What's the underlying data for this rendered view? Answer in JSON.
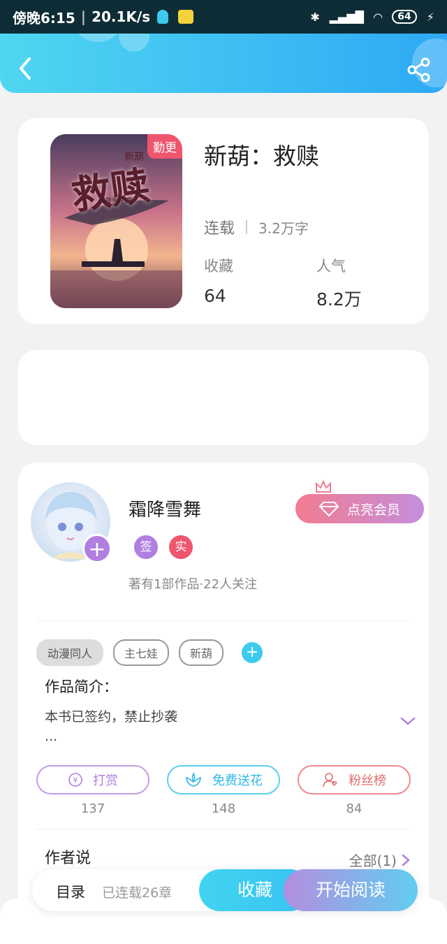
{
  "status_bar": {
    "time": "傍晚6:15",
    "speed": "20.1K/s",
    "battery": "64"
  },
  "header": {
    "back_icon": "chevron-left-icon",
    "share_icon": "share-icon"
  },
  "book": {
    "cover_badge": "勤更",
    "cover_title_art": "救赎",
    "cover_series_art": "新葫",
    "cover_author_art": "霜降雪舞 著",
    "title": "新葫：救赎",
    "status": "连载",
    "word_count": "3.2万字",
    "collect_label": "收藏",
    "collect_value": "64",
    "popularity_label": "人气",
    "popularity_value": "8.2万"
  },
  "author": {
    "name": "霜降雪舞",
    "badges": [
      "签",
      "实"
    ],
    "vip_label": "点亮会员",
    "meta": "著有1部作品·22人关注"
  },
  "tags": [
    "动漫同人",
    "主七娃",
    "新葫"
  ],
  "intro": {
    "title": "作品简介：",
    "text": "本书已签约，禁止抄袭",
    "ellipsis": "..."
  },
  "actions": [
    {
      "label": "打赏",
      "count": "137",
      "icon": "yen-icon"
    },
    {
      "label": "免费送花",
      "count": "148",
      "icon": "flower-icon"
    },
    {
      "label": "粉丝榜",
      "count": "84",
      "icon": "fan-user-icon"
    }
  ],
  "author_say": {
    "title": "作者说",
    "all_label": "全部(1)"
  },
  "bottom_bar": {
    "catalog": "目录",
    "chapters": "已连载26章",
    "collect": "收藏",
    "read": "开始阅读"
  },
  "colors": {
    "accent_blue": "#3ec9ef",
    "accent_purple": "#b07fe0",
    "accent_red": "#f0556e"
  }
}
